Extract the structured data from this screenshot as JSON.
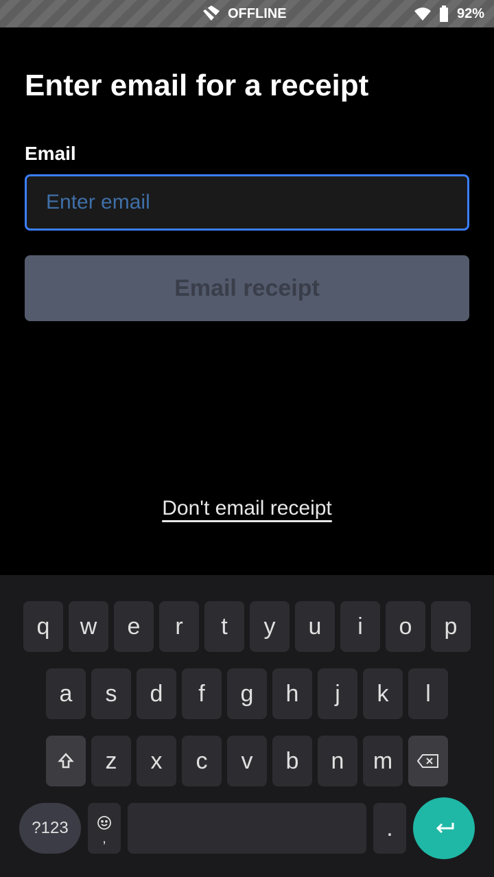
{
  "status_bar": {
    "offline_label": "OFFLINE",
    "battery_percent": "92%"
  },
  "page": {
    "title": "Enter email for a receipt",
    "field_label": "Email",
    "placeholder": "Enter email",
    "submit_label": "Email receipt",
    "skip_label": "Don't email receipt"
  },
  "keyboard": {
    "row1": [
      "q",
      "w",
      "e",
      "r",
      "t",
      "y",
      "u",
      "i",
      "o",
      "p"
    ],
    "row2": [
      "a",
      "s",
      "d",
      "f",
      "g",
      "h",
      "j",
      "k",
      "l"
    ],
    "row3": [
      "z",
      "x",
      "c",
      "v",
      "b",
      "n",
      "m"
    ],
    "numbers_key": "?123",
    "period": ".",
    "comma": ","
  }
}
